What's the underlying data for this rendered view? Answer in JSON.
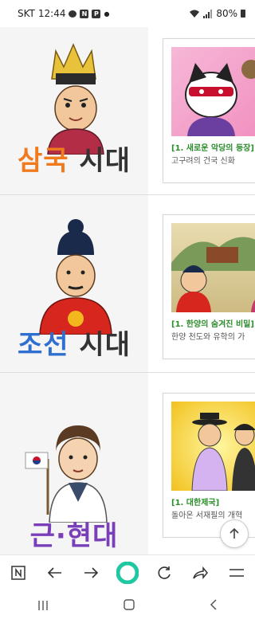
{
  "status_bar": {
    "carrier": "SKT",
    "time": "12:44",
    "battery": "80%"
  },
  "eras": [
    {
      "title_part1": "삼국",
      "title_part2": "시대",
      "title_color1": "#f07a1e",
      "title_color2": "#333333",
      "episode_title": "[1. 새로운 악당의 등장]",
      "episode_desc": "고구려의 건국 신화"
    },
    {
      "title_part1": "조선",
      "title_part2": "시대",
      "title_color1": "#2f6fcf",
      "title_color2": "#333333",
      "episode_title": "[1. 한양의 숨겨진 비밀]",
      "episode_desc": "한양 천도와 유학의 가"
    },
    {
      "title_part1": "근·현대",
      "title_part2": "",
      "title_color1": "#7a3fb8",
      "title_color2": "#7a3fb8",
      "episode_title": "[1. 대한제국]",
      "episode_desc": "돌아온 서재필의 개혁"
    }
  ],
  "browser_nav": {
    "icons": [
      "n-icon",
      "back-arrow-icon",
      "forward-arrow-icon",
      "home-circle-icon",
      "refresh-icon",
      "share-icon",
      "menu-icon"
    ],
    "accent": "#1fc8a0"
  },
  "scroll_top_icon": "arrow-up-icon"
}
